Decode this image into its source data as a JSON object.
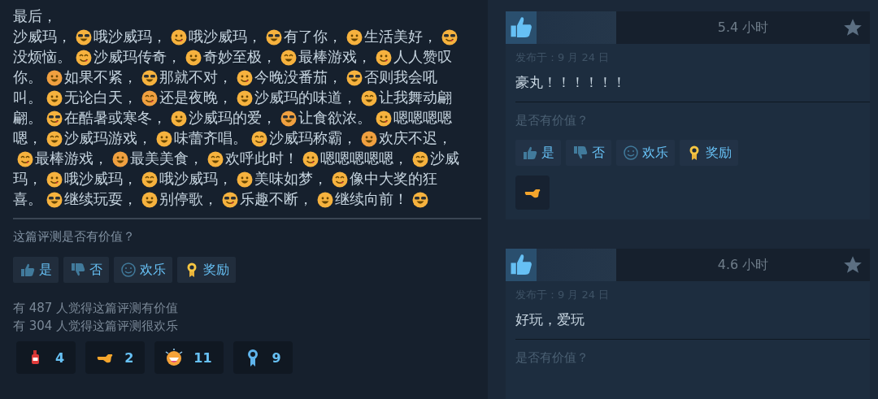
{
  "main_review": {
    "intro": "最后，",
    "lines": [
      [
        {
          "kind": "text",
          "text": "沙威玛，"
        },
        {
          "kind": "emoji"
        },
        {
          "kind": "text",
          "text": "哦沙威玛，"
        },
        {
          "kind": "emoji"
        },
        {
          "kind": "text",
          "text": "哦沙威玛，"
        },
        {
          "kind": "emoji"
        },
        {
          "kind": "text",
          "text": "有了你，"
        },
        {
          "kind": "emoji"
        },
        {
          "kind": "text",
          "text": "生活美好，"
        },
        {
          "kind": "emoji"
        }
      ],
      [
        {
          "kind": "text",
          "text": "没烦恼。"
        },
        {
          "kind": "emoji"
        },
        {
          "kind": "text",
          "text": "沙威玛传奇，"
        },
        {
          "kind": "emoji"
        },
        {
          "kind": "text",
          "text": "奇妙至极，"
        },
        {
          "kind": "emoji"
        },
        {
          "kind": "text",
          "text": "最棒游戏，"
        },
        {
          "kind": "emoji"
        },
        {
          "kind": "text",
          "text": "人人赞叹"
        }
      ],
      [
        {
          "kind": "text",
          "text": "你。"
        },
        {
          "kind": "emoji"
        },
        {
          "kind": "text",
          "text": "如果不紧，"
        },
        {
          "kind": "emoji"
        },
        {
          "kind": "text",
          "text": "那就不对，"
        },
        {
          "kind": "emoji"
        },
        {
          "kind": "text",
          "text": "今晚没番茄，"
        },
        {
          "kind": "emoji"
        },
        {
          "kind": "text",
          "text": "否则我会吼"
        }
      ],
      [
        {
          "kind": "text",
          "text": "叫。"
        },
        {
          "kind": "emoji"
        },
        {
          "kind": "text",
          "text": "无论白天，"
        },
        {
          "kind": "emoji"
        },
        {
          "kind": "text",
          "text": "还是夜晚，"
        },
        {
          "kind": "emoji"
        },
        {
          "kind": "text",
          "text": "沙威玛的味道，"
        },
        {
          "kind": "emoji"
        },
        {
          "kind": "text",
          "text": "让我舞动翩"
        }
      ],
      [
        {
          "kind": "text",
          "text": "翩。"
        },
        {
          "kind": "emoji"
        },
        {
          "kind": "text",
          "text": "在酷暑或寒冬，"
        },
        {
          "kind": "emoji"
        },
        {
          "kind": "text",
          "text": "沙威玛的爱，"
        },
        {
          "kind": "emoji"
        },
        {
          "kind": "text",
          "text": "让食欲浓。"
        },
        {
          "kind": "emoji"
        },
        {
          "kind": "text",
          "text": "嗯嗯嗯嗯"
        }
      ],
      [
        {
          "kind": "text",
          "text": "嗯，"
        },
        {
          "kind": "emoji"
        },
        {
          "kind": "text",
          "text": "沙威玛游戏，"
        },
        {
          "kind": "emoji"
        },
        {
          "kind": "text",
          "text": "味蕾齐唱。"
        },
        {
          "kind": "emoji"
        },
        {
          "kind": "text",
          "text": "沙威玛称霸，"
        },
        {
          "kind": "emoji"
        },
        {
          "kind": "text",
          "text": "欢庆不迟，"
        }
      ],
      [
        {
          "kind": "emoji"
        },
        {
          "kind": "text",
          "text": "最棒游戏，"
        },
        {
          "kind": "emoji"
        },
        {
          "kind": "text",
          "text": "最美美食，"
        },
        {
          "kind": "emoji"
        },
        {
          "kind": "text",
          "text": "欢呼此时！"
        },
        {
          "kind": "emoji"
        },
        {
          "kind": "text",
          "text": "嗯嗯嗯嗯嗯，"
        },
        {
          "kind": "emoji"
        },
        {
          "kind": "text",
          "text": "沙威"
        }
      ],
      [
        {
          "kind": "text",
          "text": "玛，"
        },
        {
          "kind": "emoji"
        },
        {
          "kind": "text",
          "text": "哦沙威玛，"
        },
        {
          "kind": "emoji"
        },
        {
          "kind": "text",
          "text": "哦沙威玛，"
        },
        {
          "kind": "emoji"
        },
        {
          "kind": "text",
          "text": "美味如梦，"
        },
        {
          "kind": "emoji"
        },
        {
          "kind": "text",
          "text": "像中大奖的狂"
        }
      ],
      [
        {
          "kind": "text",
          "text": "喜。"
        },
        {
          "kind": "emoji"
        },
        {
          "kind": "text",
          "text": "继续玩耍，"
        },
        {
          "kind": "emoji"
        },
        {
          "kind": "text",
          "text": "别停歌，"
        },
        {
          "kind": "emoji"
        },
        {
          "kind": "text",
          "text": "乐趣不断，"
        },
        {
          "kind": "emoji"
        },
        {
          "kind": "text",
          "text": "继续向前！"
        },
        {
          "kind": "emoji"
        }
      ]
    ],
    "helpful_prompt": "这篇评测是否有价值？",
    "vote_buttons": [
      {
        "kind": "yes",
        "label": "是"
      },
      {
        "kind": "no",
        "label": "否"
      },
      {
        "kind": "funny",
        "label": "欢乐"
      },
      {
        "kind": "award",
        "label": "奖励"
      }
    ],
    "stats": [
      "有 487 人觉得这篇评测有价值",
      "有 304 人觉得这篇评测很欢乐"
    ],
    "awards": [
      {
        "kind": "bottle",
        "count": "4"
      },
      {
        "kind": "hand",
        "count": "2"
      },
      {
        "kind": "laugh",
        "count": "11"
      },
      {
        "kind": "ribbon",
        "count": "9"
      }
    ]
  },
  "side_reviews": [
    {
      "recommended": true,
      "hours": "5.4 小时",
      "posted": "发布于：9 月 24 日",
      "text": "豪丸！！！！！！",
      "helpful_prompt": "是否有价值？",
      "vote_buttons": [
        {
          "kind": "yes",
          "label": "是"
        },
        {
          "kind": "no",
          "label": "否"
        },
        {
          "kind": "funny",
          "label": "欢乐"
        },
        {
          "kind": "award",
          "label": "奖励"
        }
      ],
      "awards": [
        {
          "kind": "hand"
        }
      ]
    },
    {
      "recommended": true,
      "hours": "4.6 小时",
      "posted": "发布于：9 月 24 日",
      "text": "好玩，爱玩",
      "helpful_prompt": "是否有价值？"
    }
  ]
}
